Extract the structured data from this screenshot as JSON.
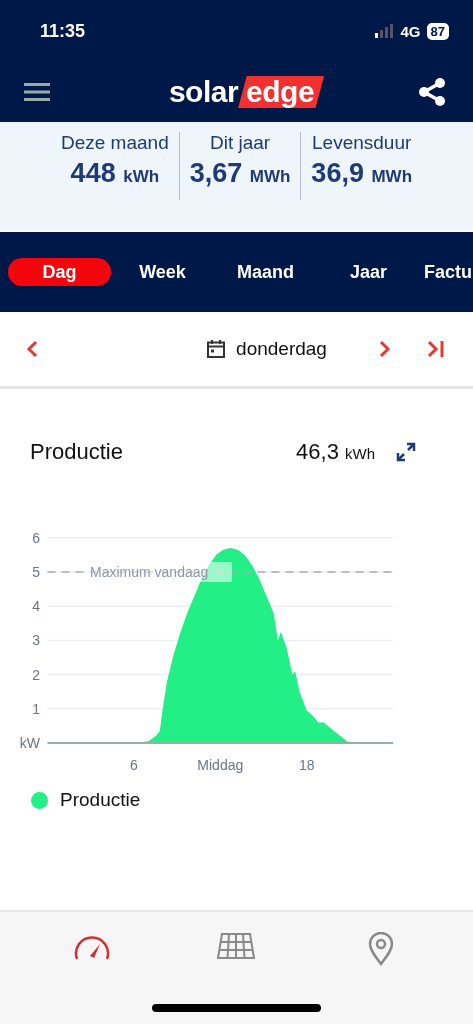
{
  "status_bar": {
    "time": "11:35",
    "network": "4G",
    "battery": "87"
  },
  "header": {
    "logo_left": "solar",
    "logo_right": "edge"
  },
  "stats": [
    {
      "label": "Deze maand",
      "value": "448",
      "unit": "kWh"
    },
    {
      "label": "Dit jaar",
      "value": "3,67",
      "unit": "MWh"
    },
    {
      "label": "Levensduur",
      "value": "36,9",
      "unit": "MWh"
    }
  ],
  "tabs": [
    {
      "label": "Dag",
      "selected": true
    },
    {
      "label": "Week",
      "selected": false
    },
    {
      "label": "Maand",
      "selected": false
    },
    {
      "label": "Jaar",
      "selected": false
    },
    {
      "label": "Factu",
      "selected": false
    }
  ],
  "date_nav": {
    "label": "donderdag"
  },
  "production": {
    "title": "Productie",
    "total": "46,3",
    "unit": "kWh",
    "chart_data": {
      "type": "area",
      "x": [
        0,
        5,
        6,
        7,
        7.5,
        7.8,
        8,
        8.3,
        8.7,
        9.2,
        9.7,
        10.2,
        10.7,
        11.2,
        11.7,
        12.2,
        12.7,
        13.2,
        13.7,
        14.2,
        14.7,
        15.2,
        15.7,
        16,
        16.2,
        16.6,
        17,
        17.2,
        17.5,
        18,
        18.4,
        18.8,
        19.2,
        19.6,
        20.2,
        20.8,
        21.2,
        24
      ],
      "series": [
        {
          "name": "Productie",
          "color": "#22ef86",
          "values": [
            0,
            0,
            0,
            0.05,
            0.2,
            0.35,
            1.0,
            1.8,
            2.5,
            3.2,
            3.8,
            4.3,
            4.8,
            5.2,
            5.5,
            5.65,
            5.7,
            5.65,
            5.5,
            5.2,
            4.8,
            4.3,
            3.8,
            3.0,
            3.25,
            2.8,
            2.0,
            2.1,
            1.5,
            0.95,
            0.8,
            0.6,
            0.6,
            0.45,
            0.25,
            0.05,
            0,
            0
          ]
        }
      ],
      "xlim": [
        0,
        24
      ],
      "ylim": [
        0,
        6
      ],
      "xticks": [
        {
          "value": 6,
          "label": "6"
        },
        {
          "value": 12,
          "label": "Middag"
        },
        {
          "value": 18,
          "label": "18"
        }
      ],
      "yticks": [
        {
          "value": 0,
          "label": "kW"
        },
        {
          "value": 1,
          "label": "1"
        },
        {
          "value": 2,
          "label": "2"
        },
        {
          "value": 3,
          "label": "3"
        },
        {
          "value": 4,
          "label": "4"
        },
        {
          "value": 5,
          "label": "5"
        },
        {
          "value": 6,
          "label": "6"
        }
      ],
      "grid": true,
      "ref_lines": [
        {
          "axis": "y",
          "value": 5,
          "label": "Maximum vandaag"
        }
      ]
    }
  },
  "bottom_nav": [
    {
      "kind": "gauge",
      "selected": true
    },
    {
      "kind": "panel",
      "selected": false
    },
    {
      "kind": "pin",
      "selected": false
    }
  ]
}
